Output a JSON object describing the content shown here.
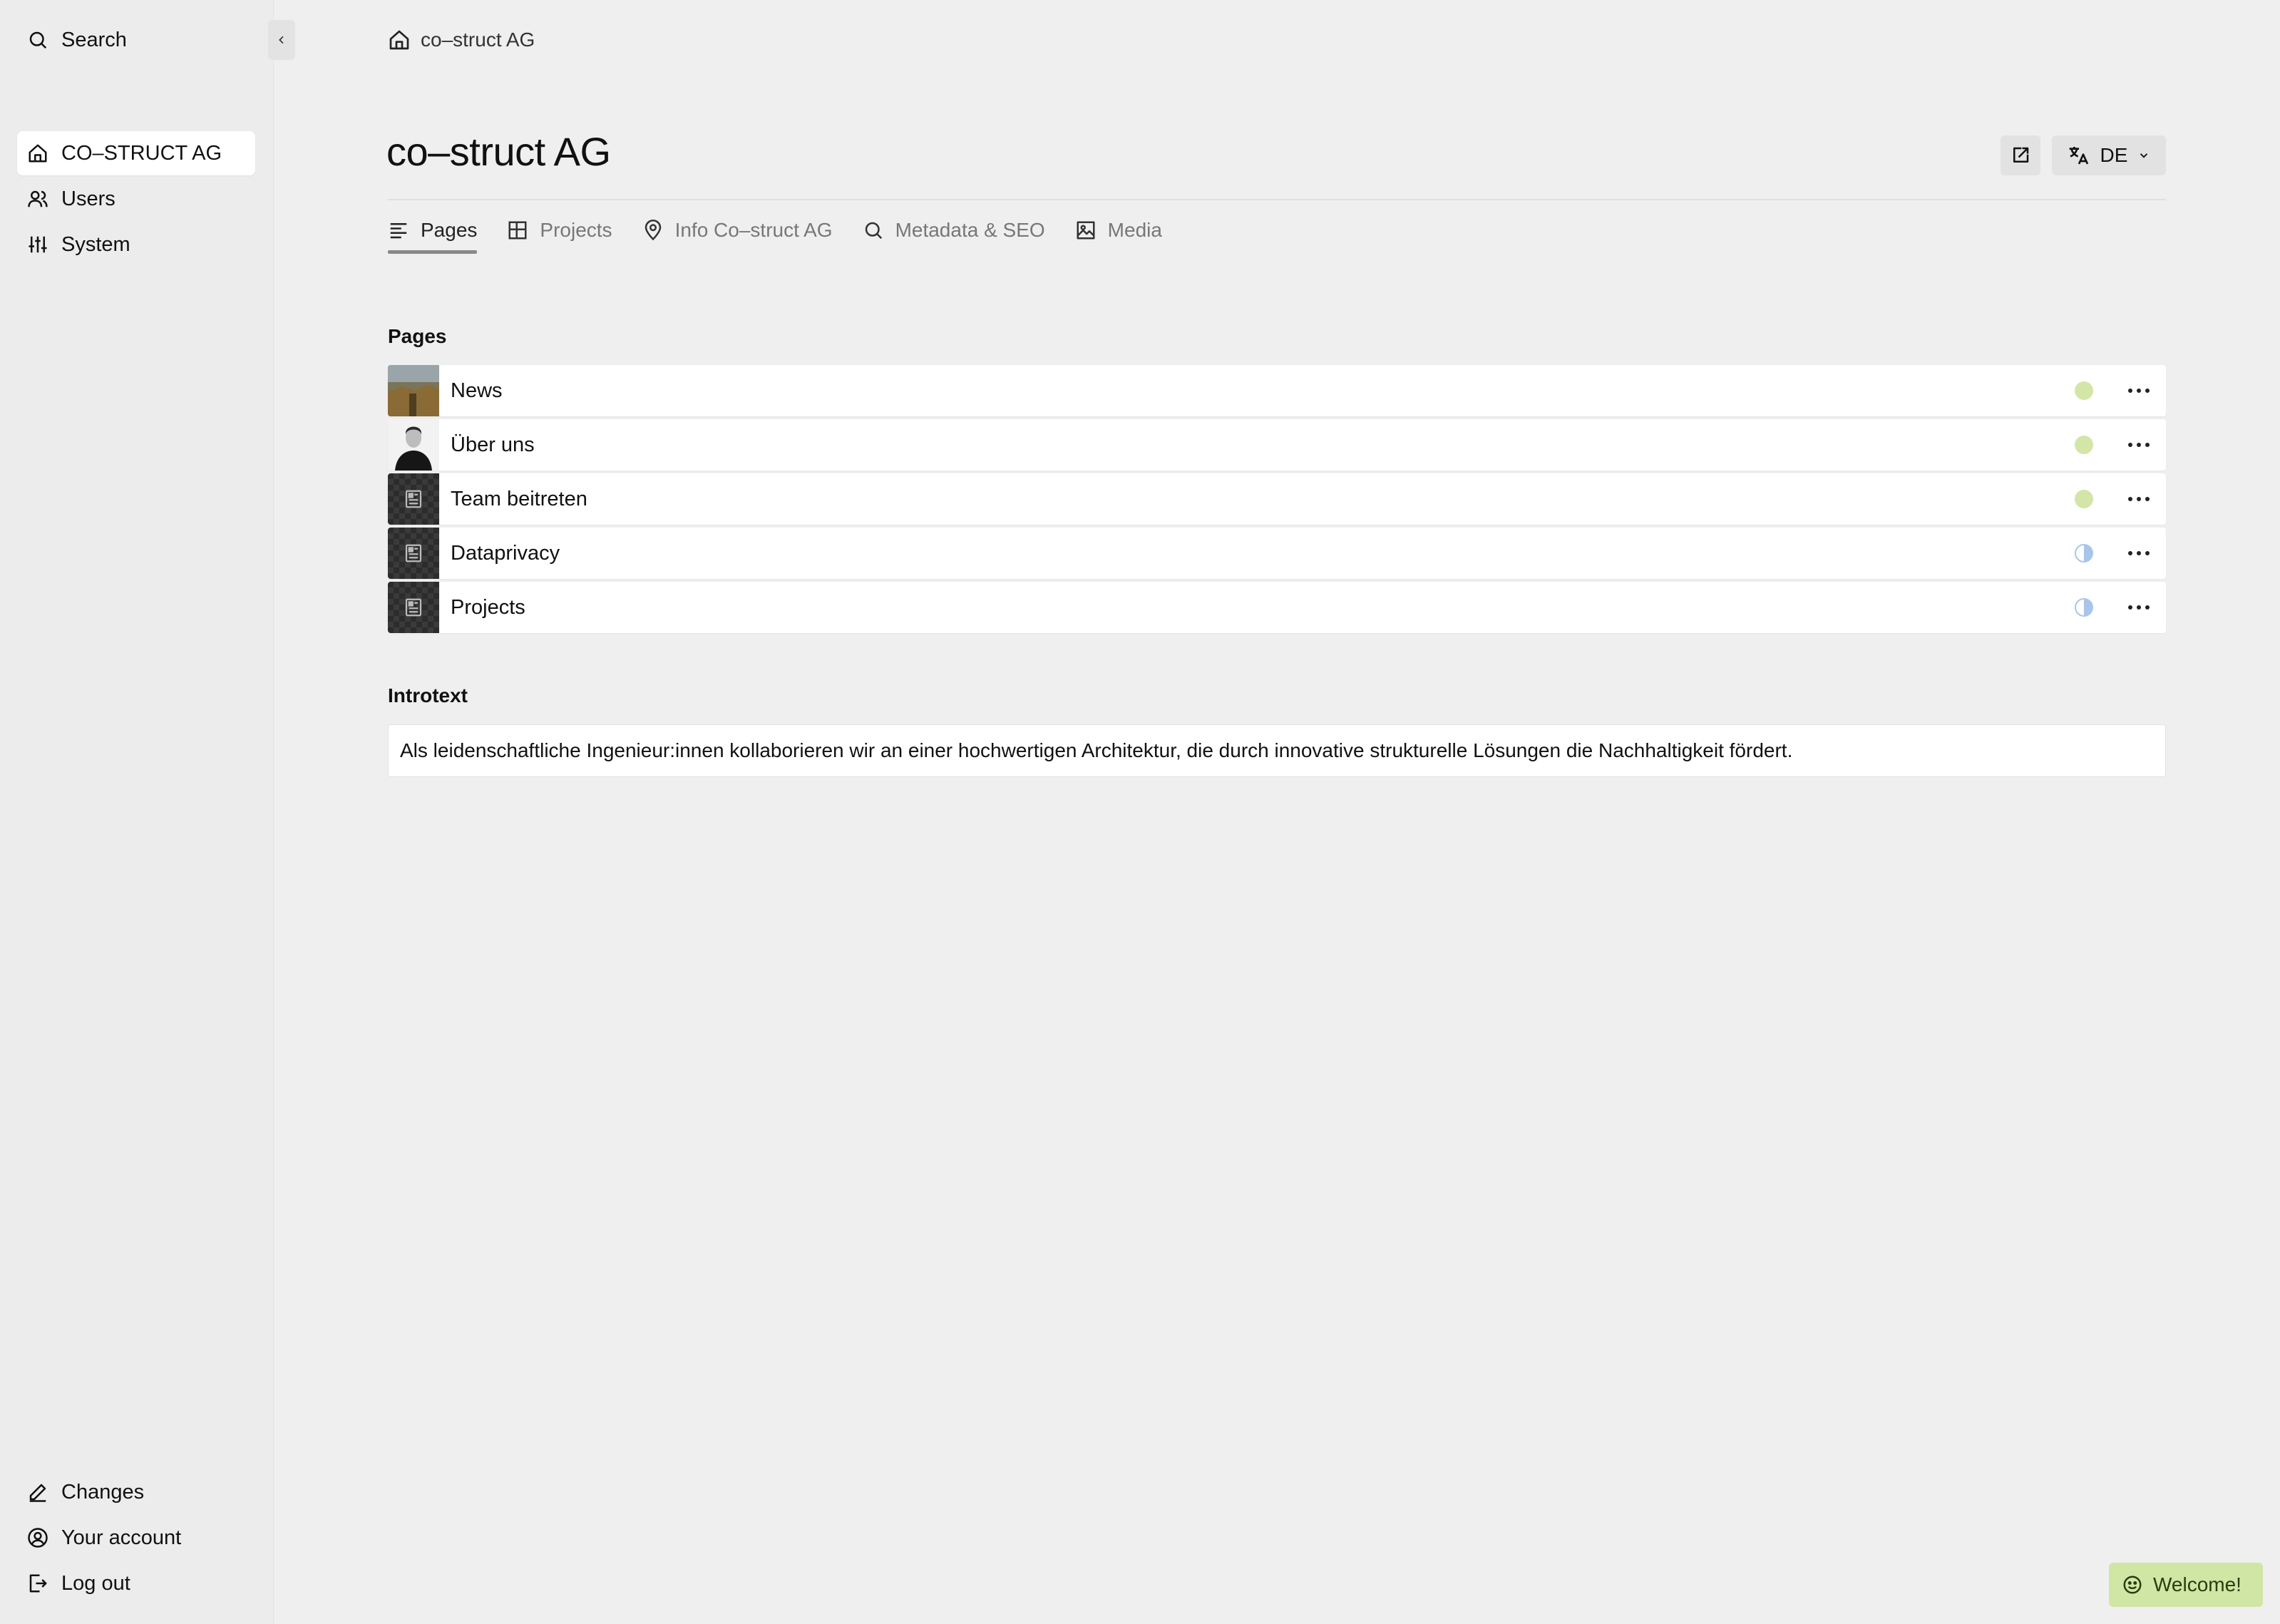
{
  "sidebar": {
    "search_label": "Search",
    "nav": [
      {
        "label": "CO–STRUCT AG",
        "icon": "home-icon"
      },
      {
        "label": "Users",
        "icon": "users-icon"
      },
      {
        "label": "System",
        "icon": "sliders-icon"
      }
    ],
    "bottom": [
      {
        "label": "Changes",
        "icon": "pen-icon"
      },
      {
        "label": "Your account",
        "icon": "account-icon"
      },
      {
        "label": "Log out",
        "icon": "logout-icon"
      }
    ]
  },
  "breadcrumb": {
    "label": "co–struct AG",
    "icon": "home-icon"
  },
  "header": {
    "title": "co–struct AG",
    "language": "DE",
    "open_icon": "external-link-icon",
    "translate_icon": "translate-icon"
  },
  "tabs": [
    {
      "label": "Pages",
      "icon": "text-lines-icon",
      "active": true
    },
    {
      "label": "Projects",
      "icon": "layout-icon",
      "active": false
    },
    {
      "label": "Info Co–struct AG",
      "icon": "map-pin-icon",
      "active": false
    },
    {
      "label": "Metadata & SEO",
      "icon": "search-icon",
      "active": false
    },
    {
      "label": "Media",
      "icon": "image-icon",
      "active": false
    }
  ],
  "pages_section": {
    "label": "Pages",
    "items": [
      {
        "title": "News",
        "status": "published",
        "thumb": "landscape"
      },
      {
        "title": "Über uns",
        "status": "published",
        "thumb": "portrait"
      },
      {
        "title": "Team beitreten",
        "status": "published",
        "thumb": "page-icon"
      },
      {
        "title": "Dataprivacy",
        "status": "unlisted",
        "thumb": "page-icon"
      },
      {
        "title": "Projects",
        "status": "unlisted",
        "thumb": "page-icon"
      }
    ]
  },
  "introtext": {
    "label": "Introtext",
    "value": "Als leidenschaftliche Ingenieur:innen kollaborieren wir an einer hochwertigen Architektur, die durch innovative strukturelle Lösungen die Nachhaltigkeit fördert."
  },
  "toast": {
    "label": "Welcome!",
    "icon": "smile-icon"
  },
  "colors": {
    "background": "#efefef",
    "status_published": "#d3e6a8",
    "status_unlisted": "#a8c6ea",
    "toast_bg": "#cfe6a5"
  }
}
